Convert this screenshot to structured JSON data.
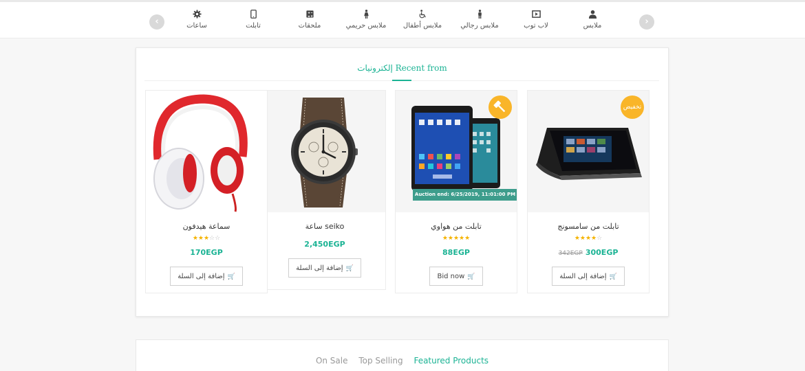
{
  "categories": [
    {
      "label": "ملابس",
      "icon": "user-icon"
    },
    {
      "label": "لاب توب",
      "icon": "video-screen-icon"
    },
    {
      "label": "ملابس رجالي",
      "icon": "male-icon"
    },
    {
      "label": "ملابس أطفال",
      "icon": "wheelchair-icon"
    },
    {
      "label": "ملابس حريمي",
      "icon": "female-icon"
    },
    {
      "label": "ملحقات",
      "icon": "calculator-icon"
    },
    {
      "label": "تابلت",
      "icon": "tablet-icon"
    },
    {
      "label": "ساعات",
      "icon": "gear-icon"
    }
  ],
  "nav": {
    "prev_symbol": "‹",
    "next_symbol": "›"
  },
  "section": {
    "title": "إلكترونيات Recent from"
  },
  "products": [
    {
      "name": "تابلت من سامسونج",
      "rating": 4,
      "max_rating": 5,
      "old_price": "342EGP",
      "price": "300EGP",
      "button_label": "إضافة إلى السلة",
      "badge": "تخفيض",
      "image": "samsung-tablet-image"
    },
    {
      "name": "تابلت من هواوي",
      "rating": 5,
      "max_rating": 5,
      "price": "88EGP",
      "button_label": "Bid now",
      "auction_text": "Auction end: 6/25/2019, 11:01:00 PM",
      "badge_icon": "gavel-icon",
      "image": "huawei-tablet-image"
    },
    {
      "name": "ساعة seiko",
      "price": "2,450EGP",
      "button_label": "إضافة إلى السلة",
      "image": "watch-image"
    },
    {
      "name": "سماعة هيدفون",
      "rating": 3,
      "max_rating": 5,
      "price": "170EGP",
      "button_label": "إضافة إلى السلة",
      "image": "headphones-image"
    }
  ],
  "tabs": [
    {
      "label": "On Sale",
      "active": false
    },
    {
      "label": "Top Selling",
      "active": false
    },
    {
      "label": "Featured Products",
      "active": true
    }
  ],
  "colors": {
    "accent": "#1bb394",
    "badge": "#f9b529",
    "stars": "#f5b301",
    "auction_strip": "#3d9d8c"
  }
}
